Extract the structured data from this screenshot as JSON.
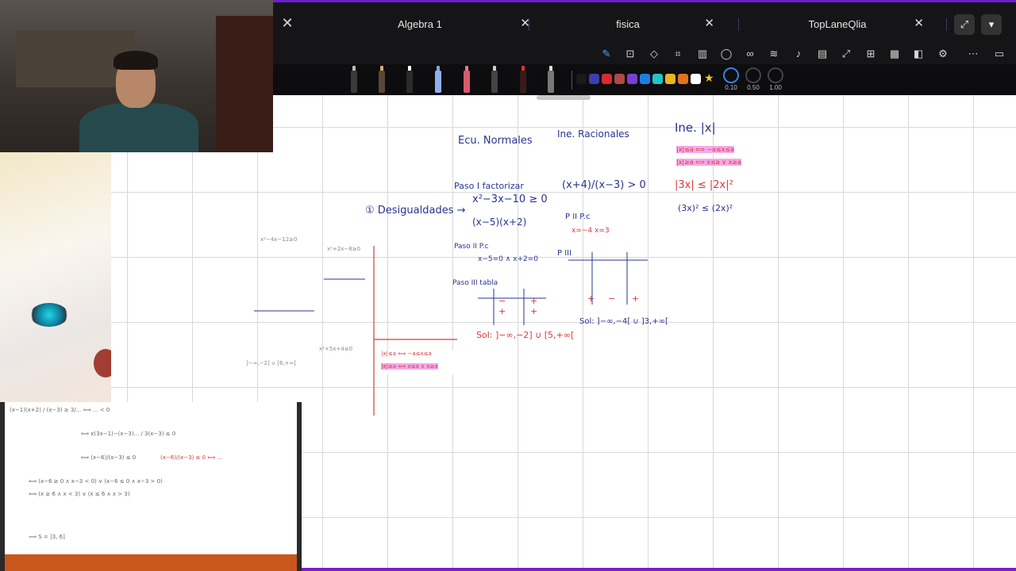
{
  "tabs": [
    {
      "label": "Algebra 1"
    },
    {
      "label": "fisica"
    },
    {
      "label": "TopLaneQlia"
    }
  ],
  "toolbar_icons": [
    "pen-icon",
    "text-box-icon",
    "shapes-icon",
    "crop-icon",
    "columns-icon",
    "comment-icon",
    "link-icon",
    "layers-icon",
    "microphone-icon",
    "reader-icon",
    "expand-icon",
    "add-page-icon",
    "grid-icon",
    "sidebar-split-icon",
    "settings-icon",
    "more-icon",
    "panel-icon"
  ],
  "colors": {
    "swatches": [
      "#1a1a1a",
      "#3d3db0",
      "#d62c2c",
      "#b04848",
      "#7a3fd0",
      "#1e7fe0",
      "#22c4c4",
      "#e6b61c",
      "#e0731e",
      "#ffffff"
    ],
    "accent": "#6b1fd6",
    "ink_blue": "#2a3390",
    "ink_red": "#d93a3a"
  },
  "thickness": [
    "0.10",
    "0.50",
    "1.00"
  ],
  "notes": {
    "ecu_normales": "Ecu. Normales",
    "inec_racionales": "Ine. Racionales",
    "inec_abs": "Ine. |x|",
    "desigualdades": "① Desigualdades →",
    "paso1": "Paso I factorizar",
    "eq1": "x²−3x−10 ≥ 0",
    "eq1_fact": "(x−5)(x+2)",
    "paso2": "Paso II P.c",
    "pc_vals": "x−5=0 ∧ x+2=0",
    "paso3": "Paso III tabla",
    "sol1": "Sol: ]−∞,−2] ∪ [5,+∞[",
    "rac_eq": "(x+4)/(x−3) > 0",
    "rac_p2": "P II P.c",
    "rac_pc": "x=−4   x=3",
    "rac_p3": "P III",
    "sol2": "Sol: ]−∞,−4[ ∪ ]3,+∞[",
    "abs1": "|x|≤a ⟺ −a≤x≤a",
    "abs2": "|x|≥a ⟺ x≤a ∨ x≥a",
    "abs_eq": "|3x| ≤ |2x|²",
    "abs_eq2": "(3x)² ≤ (2x)²"
  }
}
